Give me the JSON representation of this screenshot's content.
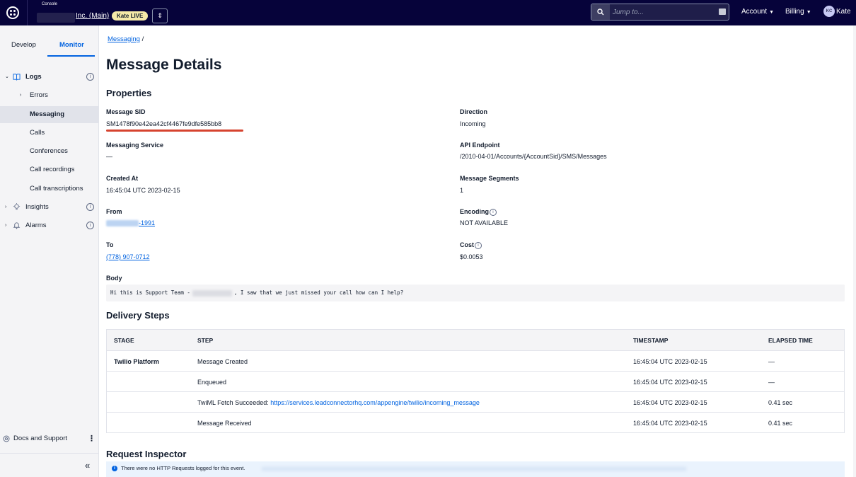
{
  "topbar": {
    "console_label": "Console",
    "account_name": "Inc. (Main)",
    "live_badge": "Kate LIVE",
    "switcher_glyph": "⇕",
    "search_placeholder": "Jump to...",
    "account_menu": "Account",
    "billing_menu": "Billing",
    "avatar_initials": "KC",
    "user_name": "Kate"
  },
  "sidebar": {
    "tabs": [
      "Develop",
      "Monitor"
    ],
    "items": [
      {
        "label": "Logs",
        "arrow": "⌄"
      },
      {
        "label": "Errors",
        "arrow": "›"
      },
      {
        "label": "Messaging"
      },
      {
        "label": "Calls"
      },
      {
        "label": "Conferences"
      },
      {
        "label": "Call recordings"
      },
      {
        "label": "Call transcriptions"
      },
      {
        "label": "Insights",
        "arrow": "›"
      },
      {
        "label": "Alarms",
        "arrow": "›"
      }
    ],
    "info_glyph": "i",
    "docs_label": "Docs and Support",
    "docs_menu_glyph": "⋮",
    "collapse_glyph": "«"
  },
  "main": {
    "breadcrumb_link": "Messaging",
    "breadcrumb_sep": " /",
    "title": "Message Details",
    "properties_title": "Properties",
    "properties": {
      "message_sid_label": "Message SID",
      "message_sid": "SM1478f90e42ea42cf4467fe9dfe585bb8",
      "direction_label": "Direction",
      "direction": "Incoming",
      "messaging_service_label": "Messaging Service",
      "messaging_service": "—",
      "api_endpoint_label": "API Endpoint",
      "api_endpoint": "/2010-04-01/Accounts/{AccountSid}/SMS/Messages",
      "created_at_label": "Created At",
      "created_at": "16:45:04 UTC 2023-02-15",
      "segments_label": "Message Segments",
      "segments": "1",
      "from_label": "From",
      "from_suffix": "-1991",
      "encoding_label": "Encoding",
      "encoding": "NOT AVAILABLE",
      "to_label": "To",
      "to": "(778) 907-0712",
      "cost_label": "Cost",
      "cost": "$0.0053",
      "body_label": "Body",
      "body_prefix": "Hi this is Support Team -",
      "body_suffix": ", I saw that we just missed your call how can I help?"
    },
    "delivery_title": "Delivery Steps",
    "table": {
      "headers": [
        "STAGE",
        "STEP",
        "TIMESTAMP",
        "ELAPSED TIME"
      ],
      "rows": [
        {
          "stage": "Twilio Platform",
          "step": "Message Created",
          "link": "",
          "timestamp": "16:45:04 UTC 2023-02-15",
          "elapsed": "—"
        },
        {
          "stage": "",
          "step": "Enqueued",
          "link": "",
          "timestamp": "16:45:04 UTC 2023-02-15",
          "elapsed": "—"
        },
        {
          "stage": "",
          "step": "TwiML Fetch Succeeded: ",
          "link": "https://services.leadconnectorhq.com/appengine/twilio/incoming_message",
          "timestamp": "16:45:04 UTC 2023-02-15",
          "elapsed": "0.41 sec"
        },
        {
          "stage": "",
          "step": "Message Received",
          "link": "",
          "timestamp": "16:45:04 UTC 2023-02-15",
          "elapsed": "0.41 sec"
        }
      ]
    },
    "inspector_title": "Request Inspector",
    "inspector_notice": "There were no HTTP Requests logged for this event.",
    "notice_glyph": "i"
  },
  "colors": {
    "topbar_bg": "#06033a",
    "accent_blue": "#0263e0",
    "highlight_red": "#d6432f",
    "live_badge_bg": "#f5e9a8"
  }
}
